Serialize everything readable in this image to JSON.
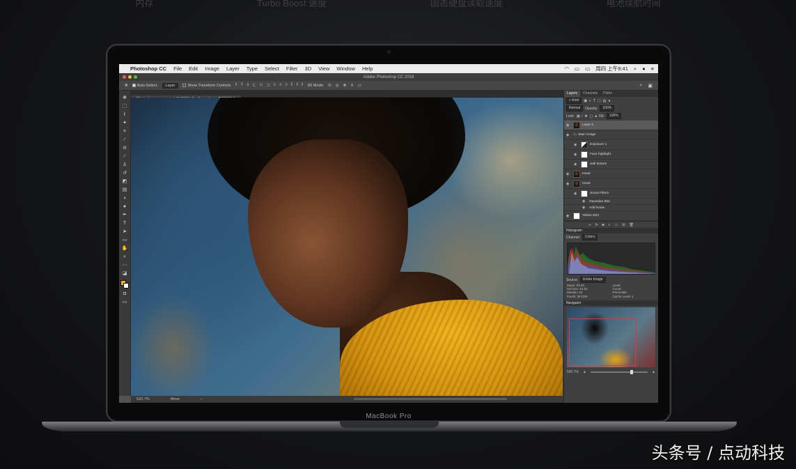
{
  "page": {
    "top_strip": [
      "内存",
      "Turbo Boost 速度",
      "固态硬盘读取速度",
      "电池续航时间"
    ],
    "laptop_label": "MacBook Pro",
    "watermark": "头条号 / 点动科技"
  },
  "menubar": {
    "app_name": "Photoshop CC",
    "items": [
      "File",
      "Edit",
      "Image",
      "Layer",
      "Type",
      "Select",
      "Filter",
      "3D",
      "View",
      "Window",
      "Help"
    ],
    "clock": "周四 上午9:41"
  },
  "window": {
    "title": "Adobe Photoshop CC 2018"
  },
  "options_bar": {
    "auto_select_label": "Auto-Select:",
    "auto_select_value": "Layer",
    "transform_label": "Show Transform Controls",
    "mode_3d": "3D Mode:"
  },
  "document": {
    "tab_label": "Photoshop screen.psd @ 521% (feather edges, RGB/8*) *",
    "zoom": "520.7%",
    "tool_label": "Move"
  },
  "layers_panel": {
    "tabs": [
      "Layers",
      "Channels",
      "Paths"
    ],
    "kind": "Kind",
    "blend_mode": "Normal",
    "opacity_label": "Opacity:",
    "opacity": "100%",
    "lock_label": "Lock:",
    "fill_label": "Fill:",
    "fill": "100%",
    "layers": [
      {
        "name": "Layer 0"
      },
      {
        "name": "Main image"
      },
      {
        "name": "Exposure 1"
      },
      {
        "name": "Face highlight"
      },
      {
        "name": "wall texture"
      },
      {
        "name": "Head"
      },
      {
        "name": "Head"
      },
      {
        "name": "Smart Filters"
      },
      {
        "name": "Gaussian Blur"
      },
      {
        "name": "Add Noise"
      },
      {
        "name": "Yellow shirt"
      }
    ]
  },
  "histogram_panel": {
    "title": "Histogram",
    "channel_label": "Channel:",
    "channel": "Colors",
    "source_label": "Source:",
    "source": "Entire Image",
    "stats_left": [
      {
        "k": "Mean:",
        "v": "84.50"
      },
      {
        "k": "Std Dev:",
        "v": "61.81"
      },
      {
        "k": "Median:",
        "v": "43"
      },
      {
        "k": "Pixels:",
        "v": "307200"
      }
    ],
    "stats_right": [
      {
        "k": "Level:",
        "v": ""
      },
      {
        "k": "Count:",
        "v": ""
      },
      {
        "k": "Percentile:",
        "v": ""
      },
      {
        "k": "Cache Level:",
        "v": "1"
      }
    ]
  },
  "navigator_panel": {
    "title": "Navigator",
    "zoom": "520.7%"
  }
}
